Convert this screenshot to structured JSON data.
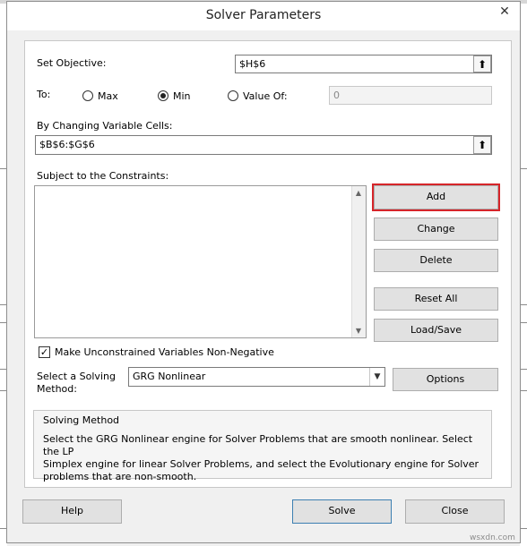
{
  "dialog": {
    "title": "Solver Parameters",
    "close_glyph": "✕"
  },
  "objective": {
    "label": "Set Objective:",
    "value": "$H$6",
    "collapse_glyph": "⬆"
  },
  "to": {
    "label": "To:",
    "options": [
      {
        "label": "Max",
        "selected": false
      },
      {
        "label": "Min",
        "selected": true
      },
      {
        "label": "Value Of:",
        "selected": false
      }
    ],
    "value_of": "0"
  },
  "changing_cells": {
    "label": "By Changing Variable Cells:",
    "value": "$B$6:$G$6",
    "collapse_glyph": "⬆"
  },
  "constraints": {
    "label": "Subject to the Constraints:",
    "items": [],
    "scroll_up_glyph": "▲",
    "scroll_down_glyph": "▼"
  },
  "constraint_buttons": {
    "add": "Add",
    "change": "Change",
    "delete": "Delete",
    "reset_all": "Reset All",
    "load_save": "Load/Save"
  },
  "nonnegative": {
    "label": "Make Unconstrained Variables Non-Negative",
    "checked": true,
    "check_glyph": "✓"
  },
  "solving_method": {
    "label_line1": "Select a Solving",
    "label_line2": "Method:",
    "selected": "GRG Nonlinear",
    "arrow_glyph": "▼",
    "options_button": "Options"
  },
  "method_info": {
    "title": "Solving Method",
    "line1": "Select the GRG Nonlinear engine for Solver Problems that are smooth nonlinear. Select the LP",
    "line2": "Simplex engine for linear Solver Problems, and select the Evolutionary engine for Solver",
    "line3": "problems that are non-smooth."
  },
  "footer": {
    "help": "Help",
    "solve": "Solve",
    "close": "Close"
  },
  "watermark": "wsxdn.com",
  "colors": {
    "highlight": "#d6252a",
    "default_button_border": "#3c7fb1"
  }
}
